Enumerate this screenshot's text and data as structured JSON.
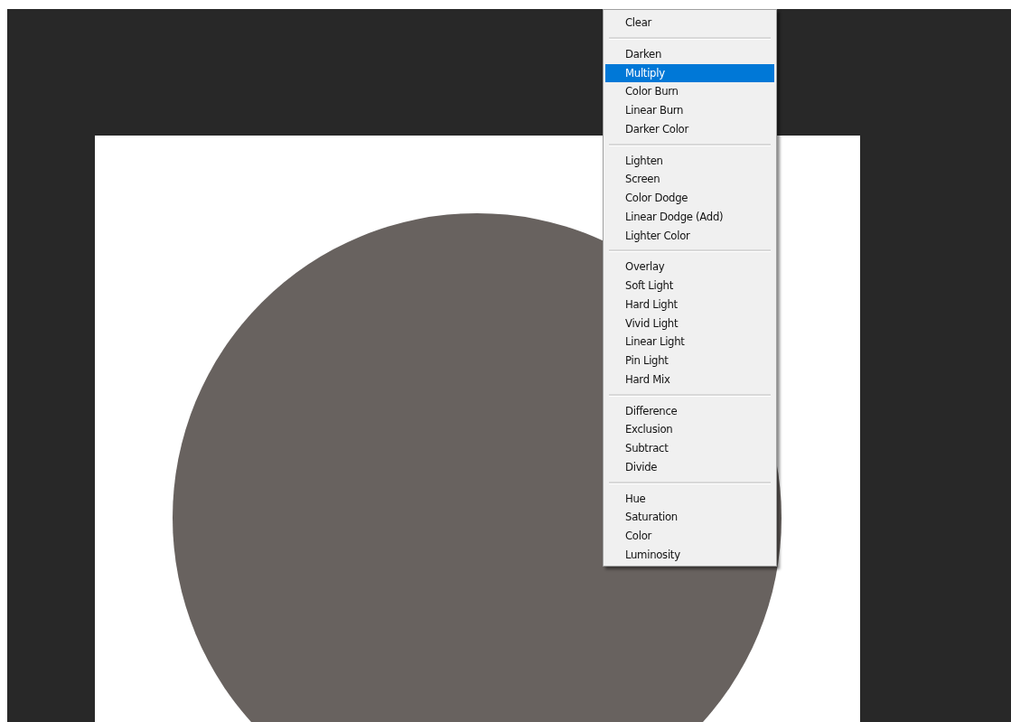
{
  "blend_menu": {
    "groups": [
      {
        "items": [
          {
            "label": "Clear",
            "selected": false
          }
        ]
      },
      {
        "items": [
          {
            "label": "Darken",
            "selected": false
          },
          {
            "label": "Multiply",
            "selected": true
          },
          {
            "label": "Color Burn",
            "selected": false
          },
          {
            "label": "Linear Burn",
            "selected": false
          },
          {
            "label": "Darker Color",
            "selected": false
          }
        ]
      },
      {
        "items": [
          {
            "label": "Lighten",
            "selected": false
          },
          {
            "label": "Screen",
            "selected": false
          },
          {
            "label": "Color Dodge",
            "selected": false
          },
          {
            "label": "Linear Dodge (Add)",
            "selected": false
          },
          {
            "label": "Lighter Color",
            "selected": false
          }
        ]
      },
      {
        "items": [
          {
            "label": "Overlay",
            "selected": false
          },
          {
            "label": "Soft Light",
            "selected": false
          },
          {
            "label": "Hard Light",
            "selected": false
          },
          {
            "label": "Vivid Light",
            "selected": false
          },
          {
            "label": "Linear Light",
            "selected": false
          },
          {
            "label": "Pin Light",
            "selected": false
          },
          {
            "label": "Hard Mix",
            "selected": false
          }
        ]
      },
      {
        "items": [
          {
            "label": "Difference",
            "selected": false
          },
          {
            "label": "Exclusion",
            "selected": false
          },
          {
            "label": "Subtract",
            "selected": false
          },
          {
            "label": "Divide",
            "selected": false
          }
        ]
      },
      {
        "items": [
          {
            "label": "Hue",
            "selected": false
          },
          {
            "label": "Saturation",
            "selected": false
          },
          {
            "label": "Color",
            "selected": false
          },
          {
            "label": "Luminosity",
            "selected": false
          }
        ]
      }
    ]
  }
}
